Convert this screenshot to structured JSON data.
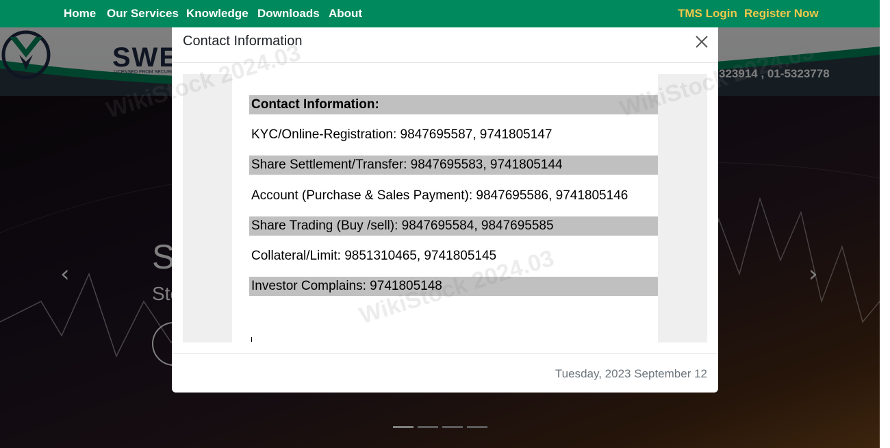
{
  "nav": {
    "home": "Home",
    "services": "Our Services",
    "knowledge": "Knowledge",
    "downloads": "Downloads",
    "about": "About",
    "tms_login": "TMS Login",
    "register": "Register Now"
  },
  "header": {
    "logo_text": "SWE",
    "logo_sub": "LICENSED FROM SECURITIE",
    "phone": "323914 , 01-5323778"
  },
  "hero": {
    "title": "S",
    "subtitle": "Sto",
    "slides_count": 4,
    "active_slide": 1,
    "prev_icon": "chevron-left-icon",
    "next_icon": "chevron-right-icon"
  },
  "modal": {
    "title": "Contact Information",
    "close_icon": "close-icon",
    "date": "Tuesday, 2023 September 12",
    "rows": [
      {
        "text": "Contact Information:",
        "shaded": true,
        "bold": true
      },
      {
        "text": "KYC/Online-Registration: 9847695587, 9741805147",
        "shaded": false,
        "bold": false
      },
      {
        "text": "Share Settlement/Transfer: 9847695583, 9741805144",
        "shaded": true,
        "bold": false
      },
      {
        "text": "Account (Purchase & Sales Payment): 9847695586, 9741805146",
        "shaded": false,
        "bold": false
      },
      {
        "text": "Share Trading (Buy /sell): 9847695584, 9847695585",
        "shaded": true,
        "bold": false
      },
      {
        "text": "Collateral/Limit: 9851310465, 9741805145",
        "shaded": false,
        "bold": false
      },
      {
        "text": "Investor Complains: 9741805148",
        "shaded": true,
        "bold": false
      }
    ]
  },
  "watermark": "WikiStock 2024.03",
  "colors": {
    "nav_bg": "#00895c",
    "nav_accent": "#f2c84b",
    "row_shade": "#c0c0c0"
  }
}
